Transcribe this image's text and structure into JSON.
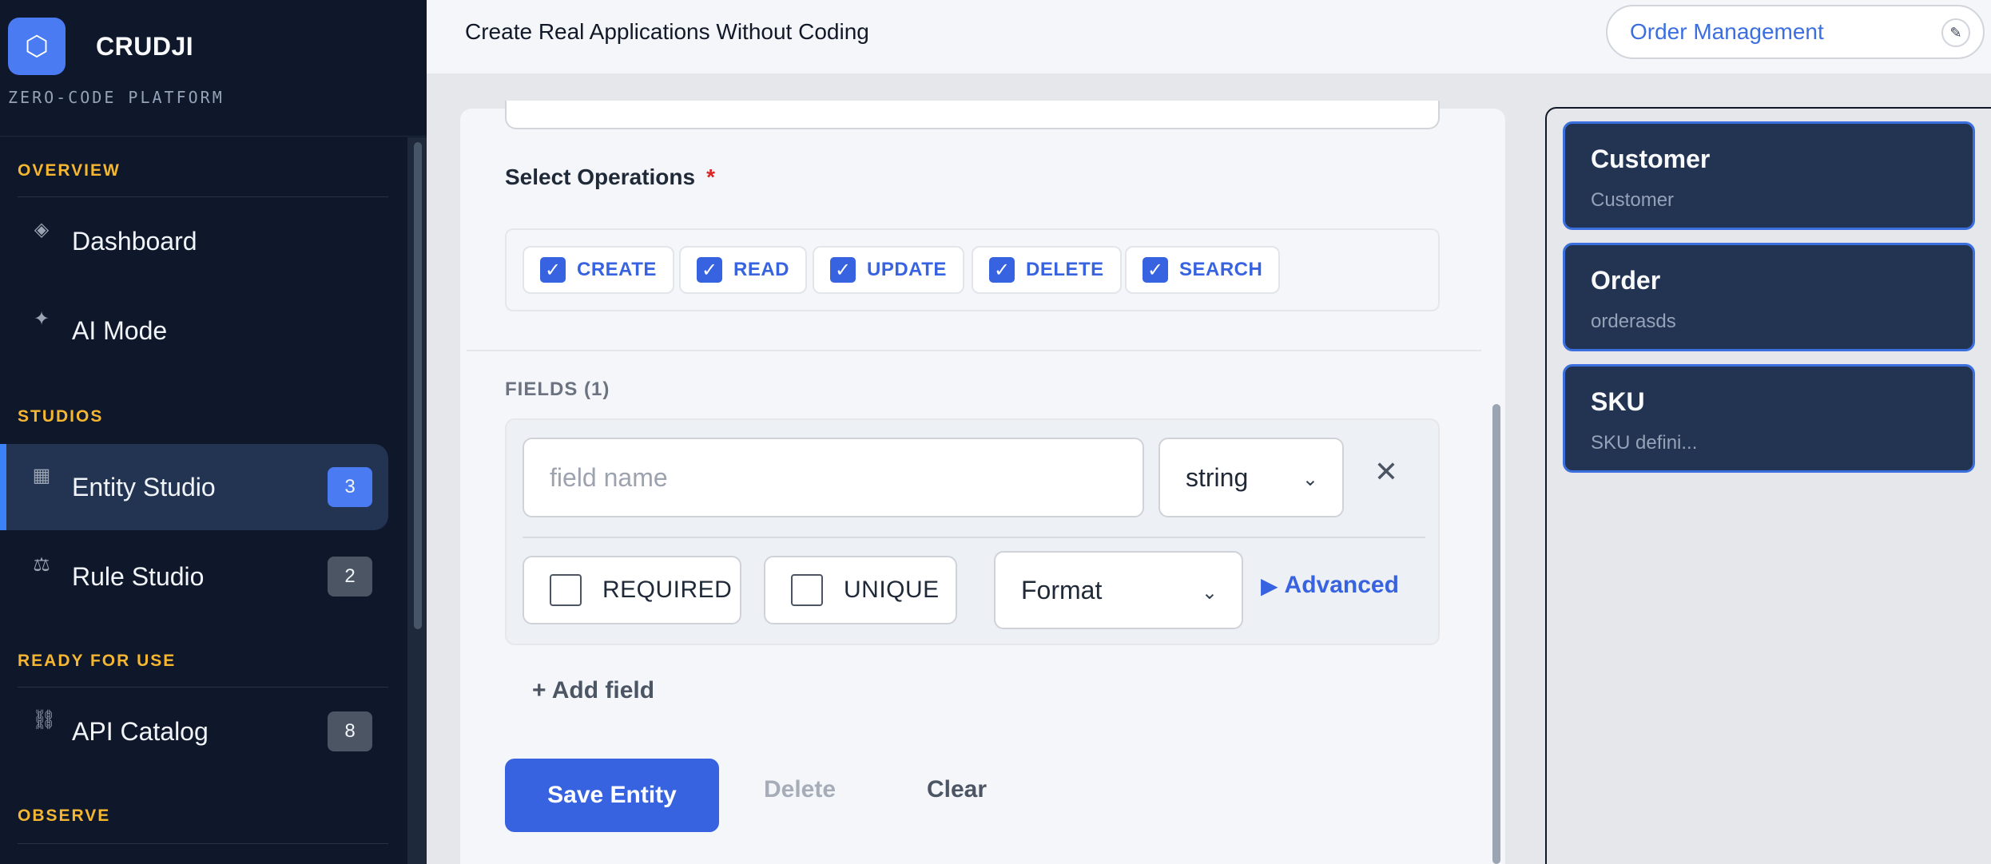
{
  "brand": {
    "logo_glyph": "⬡",
    "name": "CRUDJI",
    "tagline": "ZERO-CODE PLATFORM"
  },
  "sidebar": {
    "sections": [
      {
        "label": "OVERVIEW"
      },
      {
        "label": "STUDIOS"
      },
      {
        "label": "READY FOR USE"
      },
      {
        "label": "OBSERVE"
      }
    ],
    "items": [
      {
        "label": "Dashboard",
        "icon": "dashboard-icon",
        "glyph": "◈",
        "badge": ""
      },
      {
        "label": "AI Mode",
        "icon": "sparkle-icon",
        "glyph": "✦",
        "badge": ""
      },
      {
        "label": "Entity Studio",
        "icon": "grid-icon",
        "glyph": "▦",
        "badge": "3",
        "active": true
      },
      {
        "label": "Rule Studio",
        "icon": "scale-icon",
        "glyph": "⚖",
        "badge": "2"
      },
      {
        "label": "API Catalog",
        "icon": "link-icon",
        "glyph": "⛓",
        "badge": "8"
      }
    ]
  },
  "header": {
    "title": "Create Real Applications Without Coding",
    "project": "Order Management",
    "edit_glyph": "✎"
  },
  "form": {
    "operations_label": "Select Operations",
    "required_mark": "*",
    "operations": [
      {
        "label": "CREATE",
        "checked": true
      },
      {
        "label": "READ",
        "checked": true
      },
      {
        "label": "UPDATE",
        "checked": true
      },
      {
        "label": "DELETE",
        "checked": true
      },
      {
        "label": "SEARCH",
        "checked": true
      }
    ],
    "check_glyph": "✓",
    "fields_label": "FIELDS (1)",
    "field": {
      "name_placeholder": "field name",
      "name_value": "",
      "type_value": "string",
      "remove_glyph": "✕",
      "required_label": "REQUIRED",
      "unique_label": "UNIQUE",
      "format_value": "Format",
      "advanced_label": "Advanced",
      "advanced_glyph": "▶",
      "chevron_glyph": "⌄"
    },
    "add_field_label": "+ Add field",
    "save_label": "Save Entity",
    "delete_label": "Delete",
    "clear_label": "Clear"
  },
  "entities": [
    {
      "title": "Customer",
      "subtitle": "Customer"
    },
    {
      "title": "Order",
      "subtitle": "orderasds"
    },
    {
      "title": "SKU",
      "subtitle": "SKU defini..."
    }
  ]
}
